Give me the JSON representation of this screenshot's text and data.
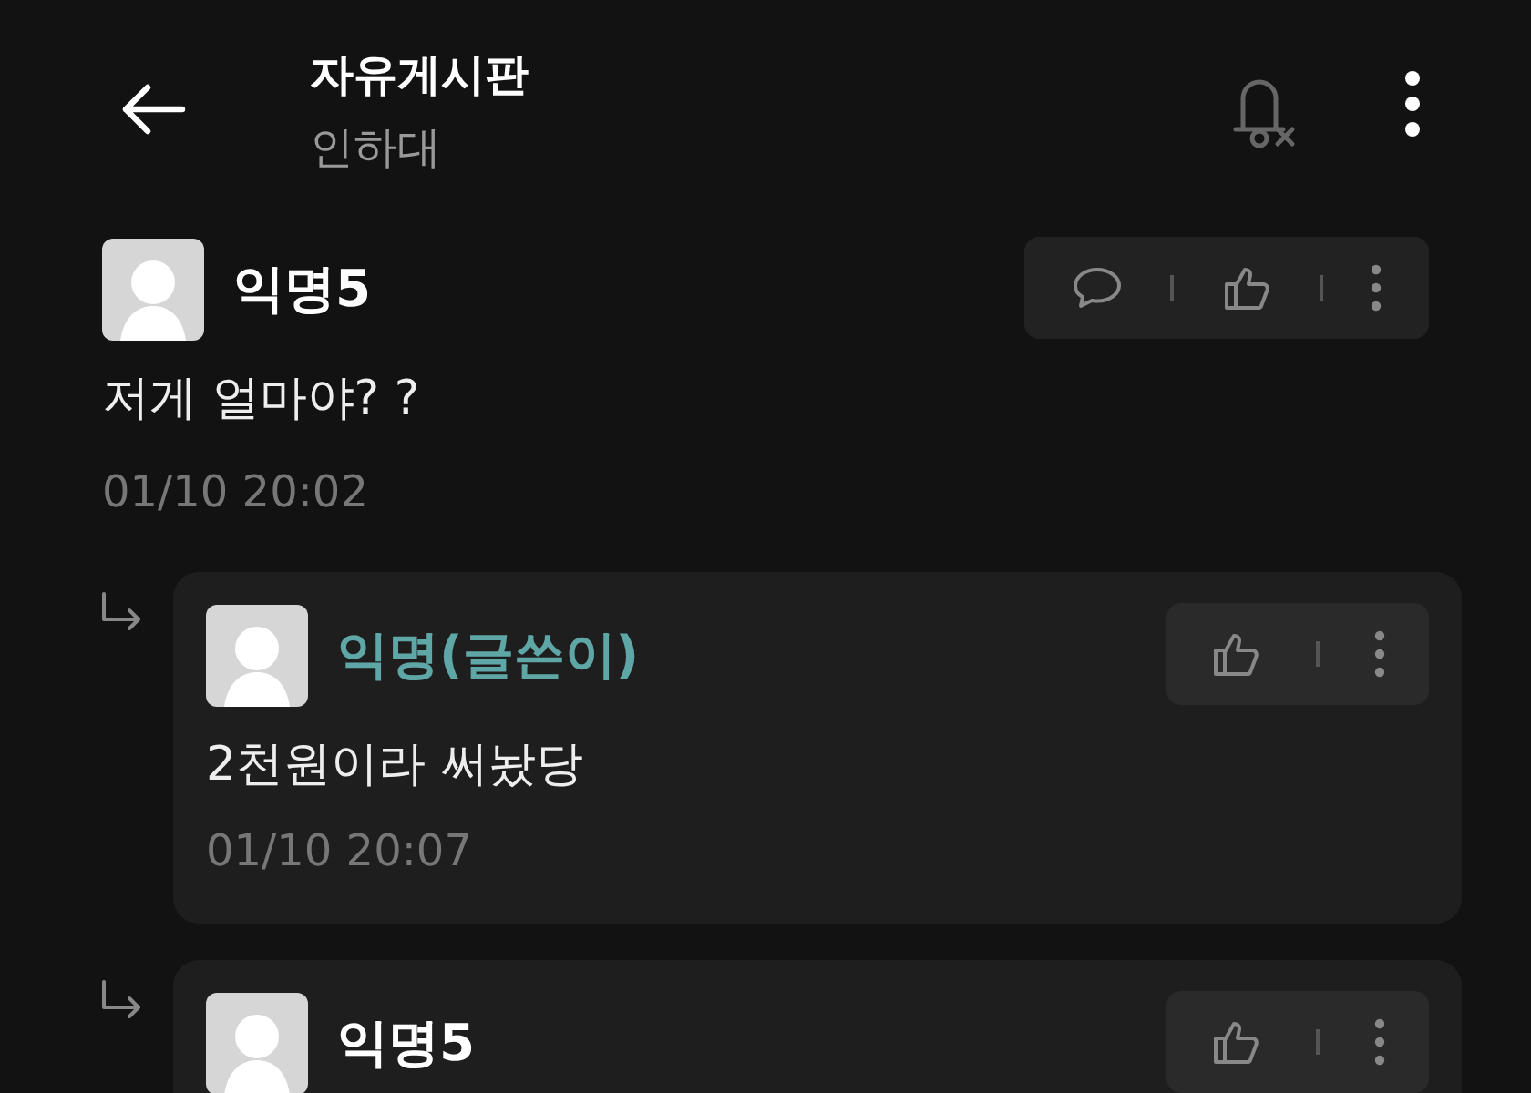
{
  "header": {
    "title": "자유게시판",
    "subtitle": "인하대"
  },
  "comment": {
    "author": "익명5",
    "writer": false,
    "body": "저게 얼마야? ?",
    "time": "01/10 20:02",
    "reply_button": true
  },
  "replies": [
    {
      "author": "익명(글쓴이)",
      "writer": true,
      "body": "2천원이라 써놨당",
      "time": "01/10 20:07",
      "reply_button": false
    },
    {
      "author": "익명5",
      "writer": false,
      "reply_button": false
    }
  ]
}
